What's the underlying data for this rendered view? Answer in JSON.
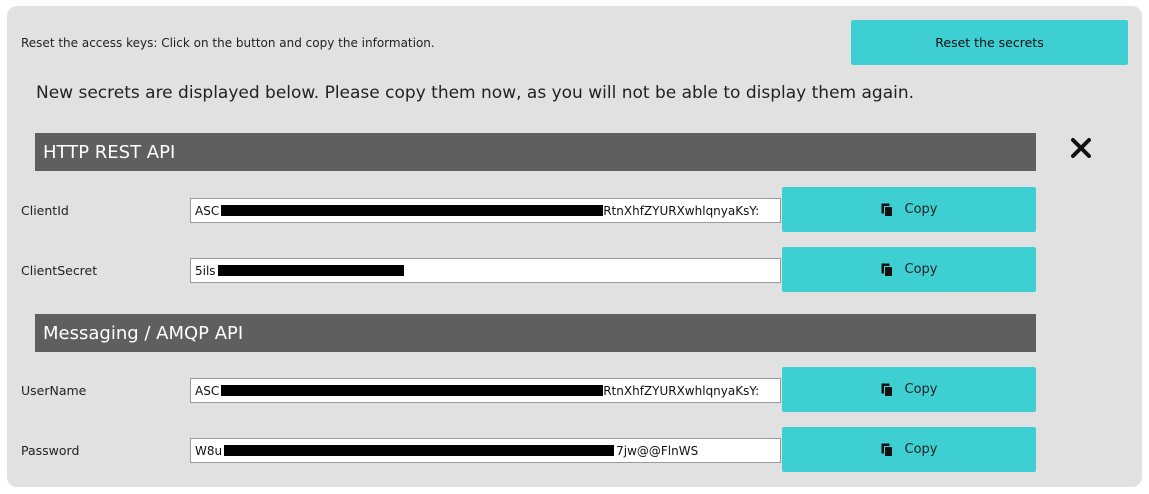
{
  "reset": {
    "instruction": "Reset the access keys: Click on the button and copy the information.",
    "button_label": "Reset the secrets"
  },
  "notice": "New secrets are displayed below. Please copy them now, as you will not be able to display them again.",
  "sections": {
    "http": {
      "title": "HTTP REST API"
    },
    "amqp": {
      "title": "Messaging / AMQP API"
    }
  },
  "fields": {
    "client_id": {
      "label": "ClientId",
      "value": "ASC",
      "value_end": "RtnXhfZYURXwhlqnyaKsY:",
      "copy_label": "Copy"
    },
    "client_secret": {
      "label": "ClientSecret",
      "value": "5ils",
      "value_end": "",
      "copy_label": "Copy"
    },
    "username": {
      "label": "UserName",
      "value": "ASC",
      "value_end": "RtnXhfZYURXwhlqnyaKsY:",
      "copy_label": "Copy"
    },
    "password": {
      "label": "Password",
      "value": "W8u",
      "value_end": "7jw@@FlnWS",
      "copy_label": "Copy"
    }
  },
  "icons": {
    "close": "close-icon",
    "copy": "copy-icon"
  },
  "colors": {
    "accent": "#3ecfd3",
    "section_header": "#5f5f5f",
    "panel_bg": "#e1e1e1"
  }
}
